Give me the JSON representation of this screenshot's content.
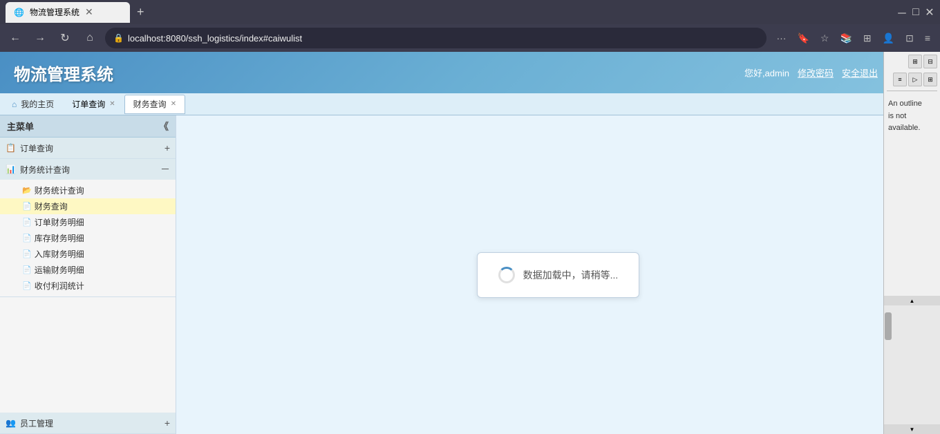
{
  "browser": {
    "tab_title": "物流管理系统",
    "url": "localhost:8080/ssh_logistics/index#caiwulist",
    "new_tab_icon": "+",
    "window_controls": {
      "minimize": "－",
      "maximize": "□",
      "close": "✕"
    },
    "nav": {
      "back": "←",
      "forward": "→",
      "refresh": "↻",
      "home": "⌂"
    },
    "toolbar_dots": "···"
  },
  "app": {
    "title": "物流管理系统",
    "header_user": "您好,admin",
    "header_change_pw": "修改密码",
    "header_logout": "安全退出",
    "tabs": [
      {
        "label": "我的主页",
        "type": "home",
        "active": false,
        "closable": false
      },
      {
        "label": "订单查询",
        "type": "normal",
        "active": false,
        "closable": true
      },
      {
        "label": "财务查询",
        "type": "normal",
        "active": true,
        "closable": true
      }
    ],
    "sidebar": {
      "title": "主菜单",
      "collapse_icon": "《",
      "sections": [
        {
          "label": "订单查询",
          "icon": "📋",
          "toggle": "+",
          "expanded": false,
          "items": []
        },
        {
          "label": "财务统计查询",
          "icon": "📊",
          "toggle": "－",
          "expanded": true,
          "sub_group": {
            "label": "财务统计查询",
            "icon": "📁",
            "items": [
              {
                "label": "财务查询",
                "active": true
              },
              {
                "label": "订单财务明细",
                "active": false
              },
              {
                "label": "库存财务明细",
                "active": false
              },
              {
                "label": "入库财务明细",
                "active": false
              },
              {
                "label": "运输财务明细",
                "active": false
              },
              {
                "label": "收付利润统计",
                "active": false
              }
            ]
          }
        },
        {
          "label": "员工管理",
          "icon": "👥",
          "toggle": "+",
          "expanded": false,
          "items": []
        }
      ]
    },
    "loading": {
      "text": "数据加载中，请稍等..."
    }
  },
  "right_panel": {
    "outline_title": "An outline",
    "outline_body": "is not\navailable."
  }
}
